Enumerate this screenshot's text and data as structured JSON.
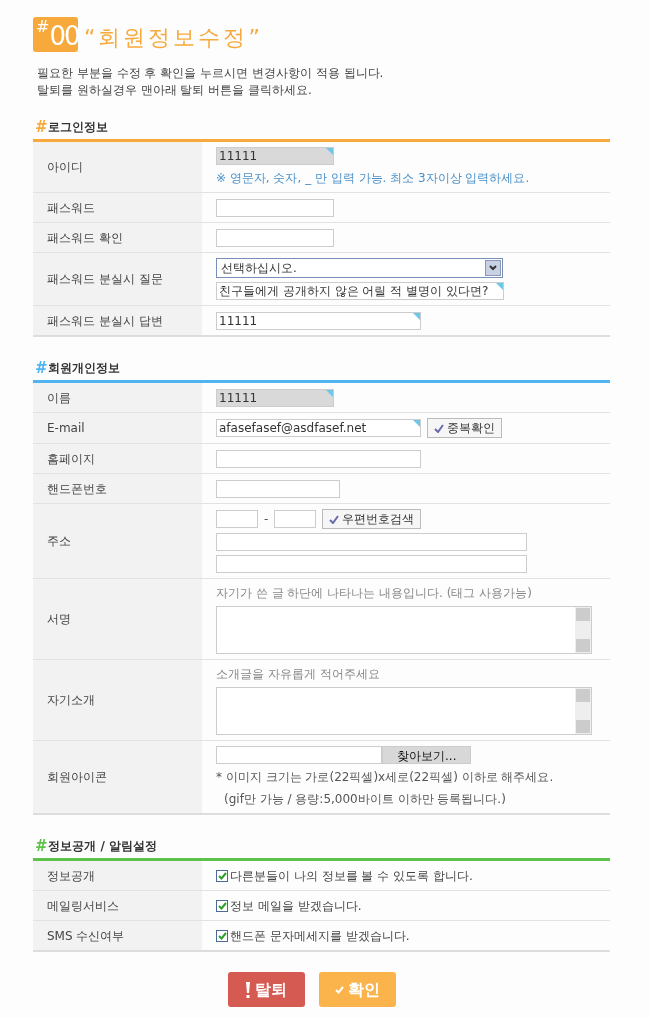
{
  "header": {
    "badge_hash": "#",
    "badge_number": "00",
    "title": "“회원정보수정”"
  },
  "intro": [
    "필요한 부분을 수정 후 확인을 누르시면 변경사항이 적용 됩니다.",
    "탈퇴를 원하실경우 맨아래 탈퇴 버튼을 클릭하세요."
  ],
  "sections": [
    {
      "hash": "#",
      "title": "로그인정보",
      "color": "#f7a93c",
      "rows": [
        {
          "label": "아이디",
          "lines": [
            [
              {
                "kind": "input",
                "value": "11111",
                "readonly": true,
                "marked": true
              }
            ],
            [
              {
                "kind": "hint",
                "text": "※ 영문자, 숫자, _ 만 입력 가능. 최소 3자이상 입력하세요."
              }
            ]
          ]
        },
        {
          "label": "패스워드",
          "lines": [
            [
              {
                "kind": "input",
                "readonly": false,
                "marked": false
              }
            ]
          ]
        },
        {
          "label": "패스워드 확인",
          "lines": [
            [
              {
                "kind": "input",
                "readonly": false,
                "marked": false
              }
            ]
          ]
        },
        {
          "label": "패스워드 분실시 질문",
          "lines": [
            [
              {
                "kind": "select",
                "value": "선택하십시오."
              }
            ],
            [
              {
                "kind": "input",
                "value": "친구들에게 공개하지 않은 어릴 적 별명이 있다면?",
                "readonly": false,
                "marked": true
              }
            ]
          ]
        },
        {
          "label": "패스워드 분실시 답변",
          "lines": [
            [
              {
                "kind": "input",
                "value": "11111",
                "readonly": false,
                "marked": true
              }
            ]
          ]
        }
      ]
    },
    {
      "hash": "#",
      "title": "회원개인정보",
      "color": "#4fb4f0",
      "rows": [
        {
          "label": "이름",
          "lines": [
            [
              {
                "kind": "input",
                "value": "11111",
                "readonly": true,
                "marked": true
              }
            ]
          ]
        },
        {
          "label": "E-mail",
          "lines": [
            [
              {
                "kind": "input",
                "value": "afasefasef@asdfasef.net",
                "readonly": false,
                "marked": true
              },
              {
                "kind": "button",
                "label": "중복확인"
              }
            ]
          ]
        },
        {
          "label": "홈페이지",
          "lines": [
            [
              {
                "kind": "input",
                "readonly": false,
                "marked": false
              }
            ]
          ]
        },
        {
          "label": "핸드폰번호",
          "lines": [
            [
              {
                "kind": "input",
                "readonly": false,
                "marked": false
              }
            ]
          ]
        },
        {
          "label": "주소",
          "lines": [
            [
              {
                "kind": "input",
                "readonly": false,
                "marked": false
              },
              {
                "kind": "text",
                "text": "-"
              },
              {
                "kind": "input",
                "readonly": false,
                "marked": false
              },
              {
                "kind": "button",
                "label": "우편번호검색"
              }
            ],
            [
              {
                "kind": "input",
                "readonly": false,
                "marked": false
              }
            ],
            [
              {
                "kind": "input",
                "readonly": false,
                "marked": false
              }
            ]
          ]
        },
        {
          "label": "서명",
          "lines": [
            [
              {
                "kind": "caption",
                "text": "자기가 쓴 글 하단에 나타나는 내용입니다. (태그 사용가능)"
              }
            ],
            [
              {
                "kind": "textarea"
              }
            ]
          ]
        },
        {
          "label": "자기소개",
          "lines": [
            [
              {
                "kind": "caption",
                "text": "소개글을 자유롭게 적어주세요"
              }
            ],
            [
              {
                "kind": "textarea"
              }
            ]
          ]
        },
        {
          "label": "회원아이콘",
          "lines": [
            [
              {
                "kind": "file",
                "label": "찾아보기..."
              }
            ],
            [
              {
                "kind": "note",
                "text": "* 이미지 크기는 가로(22픽셀)x세로(22픽셀) 이하로 해주세요."
              }
            ],
            [
              {
                "kind": "subnote",
                "text": "(gif만 가능 / 용량:5,000바이트 이하만 등록됩니다.)"
              }
            ]
          ]
        }
      ]
    },
    {
      "hash": "#",
      "title": "정보공개 / 알림설정",
      "color": "#5cc24a",
      "rows": [
        {
          "label": "정보공개",
          "lines": [
            [
              {
                "kind": "checkbox",
                "checked": true,
                "label": "다른분들이 나의 정보를 볼 수 있도록 합니다."
              }
            ]
          ]
        },
        {
          "label": "메일링서비스",
          "lines": [
            [
              {
                "kind": "checkbox",
                "checked": true,
                "label": "정보 메일을 받겠습니다."
              }
            ]
          ]
        },
        {
          "label": "SMS 수신여부",
          "lines": [
            [
              {
                "kind": "checkbox",
                "checked": true,
                "label": "핸드폰 문자메세지를 받겠습니다."
              }
            ]
          ]
        }
      ]
    }
  ],
  "buttons": [
    {
      "kind": "danger",
      "label": "탈퇴"
    },
    {
      "kind": "confirm",
      "label": "확인"
    }
  ]
}
